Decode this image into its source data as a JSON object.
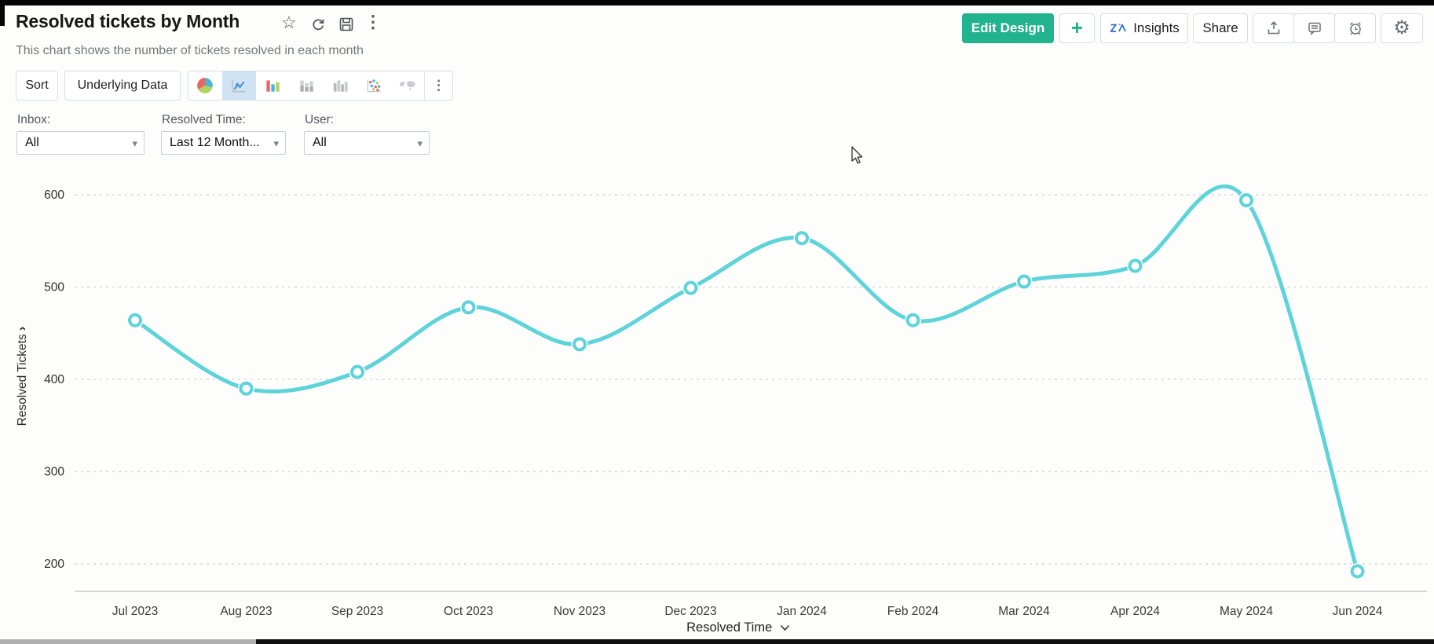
{
  "header": {
    "title": "Resolved tickets by Month",
    "subtitle": "This chart shows the number of tickets resolved in each month",
    "actions": {
      "edit_design": "Edit Design",
      "plus": "+",
      "insights": "Insights",
      "share": "Share"
    }
  },
  "toolbar": {
    "sort": "Sort",
    "underlying_data": "Underlying Data"
  },
  "filters": [
    {
      "label": "Inbox:",
      "value": "All"
    },
    {
      "label": "Resolved Time:",
      "value": "Last 12 Month..."
    },
    {
      "label": "User:",
      "value": "All"
    }
  ],
  "icons": {
    "star": "☆",
    "kebab": "⋮",
    "caret": "▾",
    "gear": "⚙",
    "chevron_right": "›"
  },
  "colors": {
    "accent": "#21b28e",
    "selected_icon_bg": "#cfe3f5",
    "zia_blue": "#2e6fd6",
    "line": "#5ed3d9"
  },
  "chart_data": {
    "type": "line",
    "title": "Resolved tickets by Month",
    "categories": [
      "Jul 2023",
      "Aug 2023",
      "Sep 2023",
      "Oct 2023",
      "Nov 2023",
      "Dec 2023",
      "Jan 2024",
      "Feb 2024",
      "Mar 2024",
      "Apr 2024",
      "May 2024",
      "Jun 2024"
    ],
    "values": [
      464,
      390,
      408,
      478,
      438,
      499,
      553,
      464,
      506,
      523,
      594,
      192
    ],
    "xlabel": "Resolved Time",
    "ylabel": "Resolved Tickets",
    "yticks": [
      200,
      300,
      400,
      500,
      600
    ],
    "ylim": [
      150,
      620
    ],
    "grid": "horizontal-dashed",
    "legend": "none",
    "line_color": "#5ed3d9",
    "marker": "ring"
  }
}
